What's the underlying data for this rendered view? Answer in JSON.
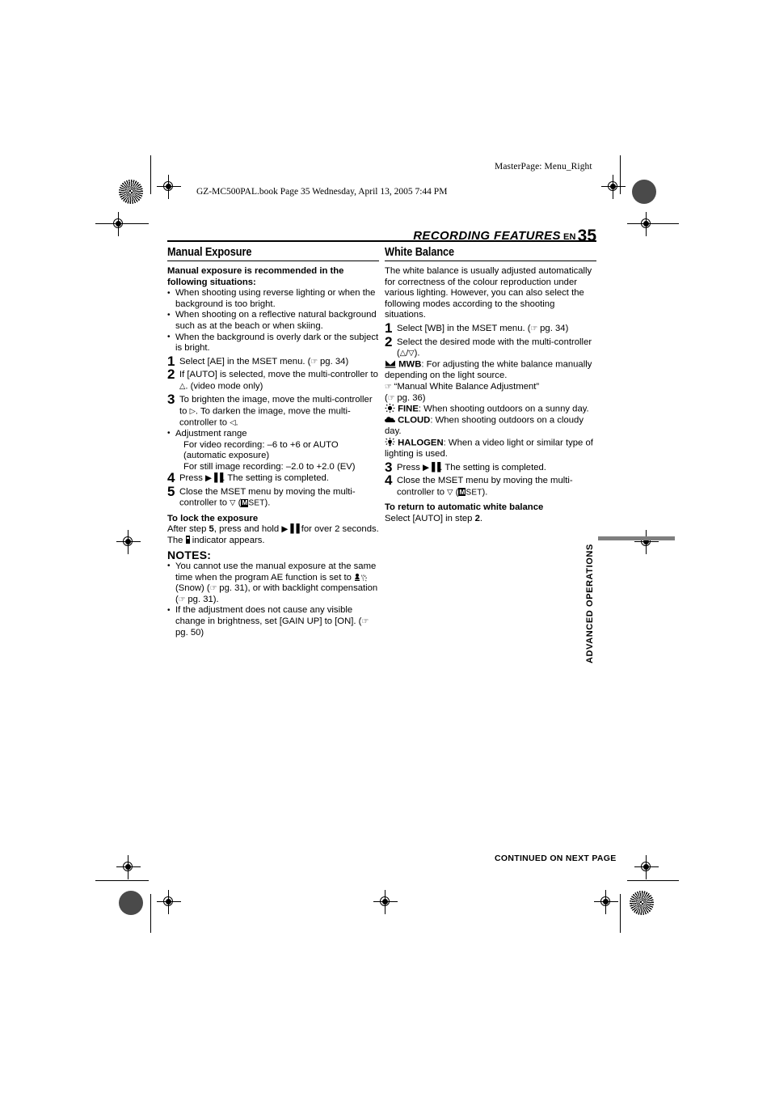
{
  "page": {
    "masterpage_note": "MasterPage: Menu_Right",
    "book_line": "GZ-MC500PAL.book  Page 35  Wednesday, April 13, 2005  7:44 PM",
    "running_head_title": "RECORDING FEATURES",
    "running_head_lang": "EN",
    "page_number": "35",
    "vertical_tab": "ADVANCED OPERATIONS",
    "footer": "CONTINUED ON NEXT PAGE",
    "tab_bar_color": "#7f7f7f"
  },
  "left_column": {
    "title": "Manual Exposure",
    "intro_bold": "Manual exposure is recommended in the following situations:",
    "bullets": [
      "When shooting using reverse lighting or when the background is too bright.",
      "When shooting on a reflective natural background such as at the beach or when skiing.",
      "When the background is overly dark or the subject is bright."
    ],
    "steps": [
      {
        "num": "1",
        "text_a": "Select [AE] in the MSET menu. (",
        "ptr": "☞",
        "text_b": " pg. 34)"
      },
      {
        "num": "2",
        "text_a": "If [AUTO] is selected, move the multi-controller to ",
        "sym": "△",
        "text_b": ". (video mode only)"
      },
      {
        "num": "3",
        "text_a": "To brighten the image, move the multi-controller to ",
        "sym": "▷",
        "text_b": ". To darken the image, move the multi-controller to ",
        "sym2": "◁",
        "text_c": "."
      },
      {
        "num": "4",
        "text_a": "Press ",
        "sym": "▶▐▐",
        "text_b": ". The setting is completed."
      },
      {
        "num": "5",
        "text_a": "Close the MSET menu by moving the multi-controller to ",
        "sym": "▽",
        "text_b": " (",
        "mset_box": "M",
        "mset_word": "SET",
        "text_c": ")."
      }
    ],
    "adjustment_bullet": "Adjustment range",
    "adjustment_lines": [
      "For video recording: –6 to +6 or AUTO (automatic exposure)",
      "For still image recording: –2.0 to +2.0 (EV)"
    ],
    "lock_head": "To lock the exposure",
    "lock_text_a": "After step ",
    "lock_step": "5",
    "lock_text_b": ", press and hold ",
    "lock_sym": "▶▐▐",
    "lock_text_c": " for over 2 seconds. The ",
    "lock_text_d": " indicator appears.",
    "notes_head": "NOTES:",
    "notes": [
      {
        "a": "You cannot use the manual exposure at the same time when the program AE function is set to ",
        "icon": "snow-icon",
        "b": " (Snow) (",
        "ptr": "☞",
        "c": " pg. 31), or with backlight compensation (",
        "ptr2": "☞",
        "d": " pg. 31)."
      },
      {
        "a": "If the adjustment does not cause any visible change in brightness, set [GAIN UP] to [ON]. (",
        "ptr": "☞",
        "b": " pg. 50)"
      }
    ]
  },
  "right_column": {
    "title": "White Balance",
    "intro": "The white balance is usually adjusted automatically for correctness of the colour reproduction under various lighting. However, you can also select the following modes according to the shooting situations.",
    "steps": [
      {
        "num": "1",
        "text_a": "Select [WB] in the MSET menu. (",
        "ptr": "☞",
        "text_b": " pg. 34)"
      },
      {
        "num": "2",
        "text_a": "Select the desired mode with the multi-controller (",
        "sym": "△/▽",
        "text_b": ")."
      },
      {
        "num": "3",
        "text_a": "Press ",
        "sym": "▶▐▐",
        "text_b": ". The setting is completed."
      },
      {
        "num": "4",
        "text_a": "Close the MSET menu by moving the multi-controller to ",
        "sym": "▽",
        "text_b": " (",
        "mset_box": "M",
        "mset_word": "SET",
        "text_c": ")."
      }
    ],
    "modes": [
      {
        "icon": "mwb-icon",
        "label": "MWB",
        "text": ": For adjusting the white balance manually depending on the light source."
      },
      {
        "icon": "fine-icon",
        "label": "FINE",
        "text": ": When shooting outdoors on a sunny day."
      },
      {
        "icon": "cloud-icon",
        "label": "CLOUD",
        "text": ": When shooting outdoors on a cloudy day."
      },
      {
        "icon": "halogen-icon",
        "label": "HALOGEN",
        "text": ": When a video light or similar type of lighting is used."
      }
    ],
    "mwb_ref_a": "“Manual White Balance Adjustment”",
    "mwb_ref_b": " pg. 36)",
    "mwb_ref_open": "(",
    "ptr": "☞",
    "auto_head": "To return to automatic white balance",
    "auto_text_a": "Select [AUTO] in step ",
    "auto_step": "2",
    "auto_text_b": "."
  }
}
